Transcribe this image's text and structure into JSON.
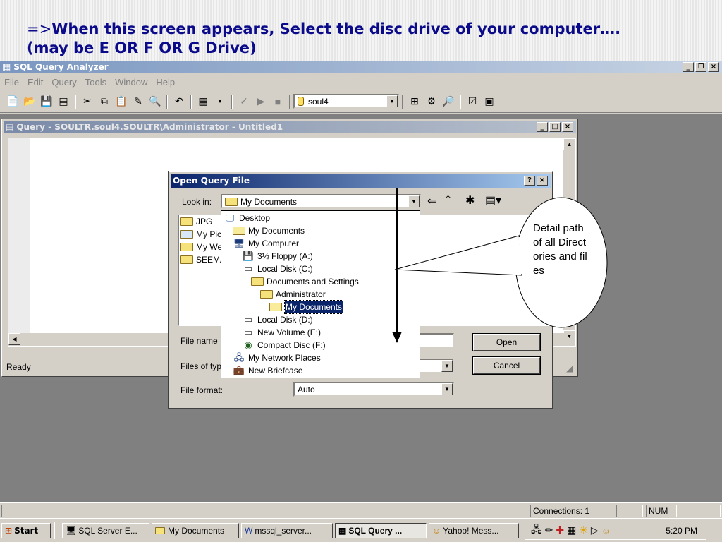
{
  "caption": {
    "arrow": "=>",
    "line1": "When this screen appears, Select the disc drive of your computer….",
    "line2": "(may be E OR F OR G Drive)"
  },
  "app": {
    "title": "SQL Query Analyzer",
    "menu": [
      "File",
      "Edit",
      "Query",
      "Tools",
      "Window",
      "Help"
    ],
    "database": "soul4",
    "status": "Ready"
  },
  "query_window": {
    "title": "Query - SOULTR.soul4.SOULTR\\Administrator - Untitled1"
  },
  "dialog": {
    "title": "Open Query File",
    "look_in_label": "Look in:",
    "look_in_value": "My Documents",
    "files": [
      "JPG",
      "My Pic",
      "My We",
      "SEEMA"
    ],
    "file_name_label": "File name",
    "files_of_type_label": "Files of typ",
    "file_format_label": "File format:",
    "file_format_value": "Auto",
    "open_button": "Open",
    "cancel_button": "Cancel"
  },
  "dropdown_items": [
    {
      "label": "Desktop",
      "indent": 0,
      "icon": "desktop-icon"
    },
    {
      "label": "My Documents",
      "indent": 1,
      "icon": "folder-open-icon"
    },
    {
      "label": "My Computer",
      "indent": 1,
      "icon": "computer-icon"
    },
    {
      "label": "3½ Floppy (A:)",
      "indent": 2,
      "icon": "floppy-icon"
    },
    {
      "label": "Local Disk (C:)",
      "indent": 2,
      "icon": "disk-icon"
    },
    {
      "label": "Documents and Settings",
      "indent": 3,
      "icon": "folder-icon"
    },
    {
      "label": "Administrator",
      "indent": 4,
      "icon": "folder-icon"
    },
    {
      "label": "My Documents",
      "indent": 5,
      "icon": "folder-open-icon",
      "selected": true
    },
    {
      "label": "Local Disk (D:)",
      "indent": 2,
      "icon": "disk-icon"
    },
    {
      "label": "New Volume (E:)",
      "indent": 2,
      "icon": "disk-icon"
    },
    {
      "label": "Compact Disc (F:)",
      "indent": 2,
      "icon": "cd-icon"
    },
    {
      "label": "My Network Places",
      "indent": 1,
      "icon": "network-icon"
    },
    {
      "label": "New Briefcase",
      "indent": 1,
      "icon": "briefcase-icon"
    }
  ],
  "callout": {
    "text": "Detail path of all Directories and files"
  },
  "statusbar": {
    "connections": "Connections: 1",
    "num": "NUM"
  },
  "taskbar": {
    "start": "Start",
    "tasks": [
      {
        "label": "SQL Server E...",
        "active": false
      },
      {
        "label": "My Documents",
        "active": false
      },
      {
        "label": "mssql_server...",
        "active": false
      },
      {
        "label": "SQL Query ...",
        "active": true
      },
      {
        "label": "Yahoo! Mess...",
        "active": false
      }
    ],
    "clock": "5:20 PM"
  }
}
